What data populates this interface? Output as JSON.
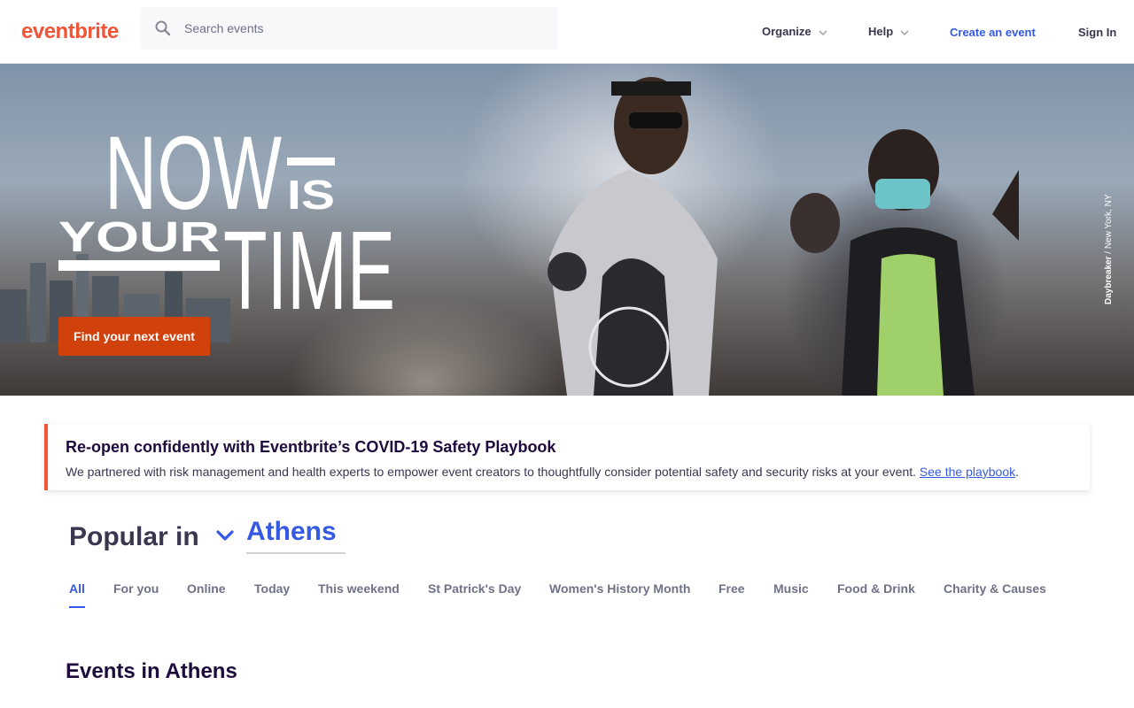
{
  "header": {
    "logo": "eventbrite",
    "search_placeholder": "Search events",
    "nav": {
      "organize": "Organize",
      "help": "Help",
      "create": "Create an event",
      "signin": "Sign In"
    }
  },
  "hero": {
    "headline_now": "NOW",
    "headline_is": "IS",
    "headline_your": "YOUR",
    "headline_time": "TIME",
    "cta": "Find your next event",
    "credit_name": "Daybreaker",
    "credit_place": "New York, NY"
  },
  "banner": {
    "title": "Re-open confidently with Eventbrite’s COVID-19 Safety Playbook",
    "body": "We partnered with risk management and health experts to empower event creators to thoughtfully consider potential safety and security risks at your event.",
    "link": "See the playbook",
    "period": "."
  },
  "popular": {
    "label": "Popular in",
    "city": "Athens"
  },
  "tabs": [
    "All",
    "For you",
    "Online",
    "Today",
    "This weekend",
    "St Patrick's Day",
    "Women's History Month",
    "Free",
    "Music",
    "Food & Drink",
    "Charity & Causes"
  ],
  "events_heading": "Events in Athens",
  "colors": {
    "brand": "#f05537",
    "accent": "#3659e3",
    "cta": "#d1410c"
  }
}
